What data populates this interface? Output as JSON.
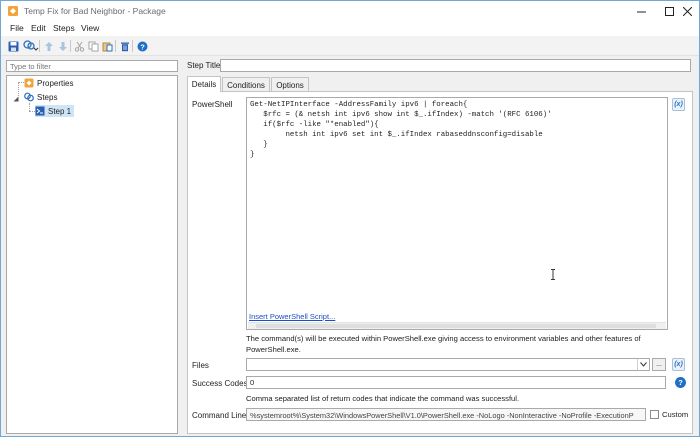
{
  "window": {
    "title": "Temp Fix for Bad Neighbor - Package"
  },
  "menu": [
    "File",
    "Edit",
    "Steps",
    "View"
  ],
  "toolbar": {
    "icons": [
      "save-icon",
      "add-step-icon",
      "move-up-icon",
      "move-down-icon",
      "cut-icon",
      "copy-icon",
      "paste-icon",
      "delete-icon",
      "help-icon"
    ]
  },
  "sidebar": {
    "filter_placeholder": "Type to filter",
    "tree": {
      "properties": "Properties",
      "steps": "Steps",
      "step1": "Step 1"
    }
  },
  "step": {
    "title_label": "Step Title",
    "title_value": ""
  },
  "tabs": [
    "Details",
    "Conditions",
    "Options"
  ],
  "details": {
    "powershell_label": "PowerShell",
    "script": "Get-NetIPInterface -AddressFamily ipv6 | foreach{\n   $rfc = (& netsh int ipv6 show int $_.ifIndex) -match '(RFC 6106)'\n   if($rfc -like \"*enabled\"){\n        netsh int ipv6 set int $_.ifIndex rabaseddnsconfig=disable\n   }\n}",
    "insert_link": "Insert PowerShell Script...",
    "variable_button": "(x)",
    "description": "The command(s) will be executed within PowerShell.exe giving access to environment variables and other features of PowerShell.exe.",
    "files_label": "Files",
    "files_value": "",
    "files_browse": "...",
    "success_codes_label": "Success Codes",
    "success_codes_value": "0",
    "success_codes_hint": "Comma separated list of return codes that indicate the command was successful.",
    "command_line_label": "Command Line",
    "command_line_value": "%systemroot%\\System32\\WindowsPowerShell\\V1.0\\PowerShell.exe -NoLogo -NonInteractive -NoProfile -ExecutionP",
    "custom_label": "Custom",
    "custom_checked": false
  }
}
